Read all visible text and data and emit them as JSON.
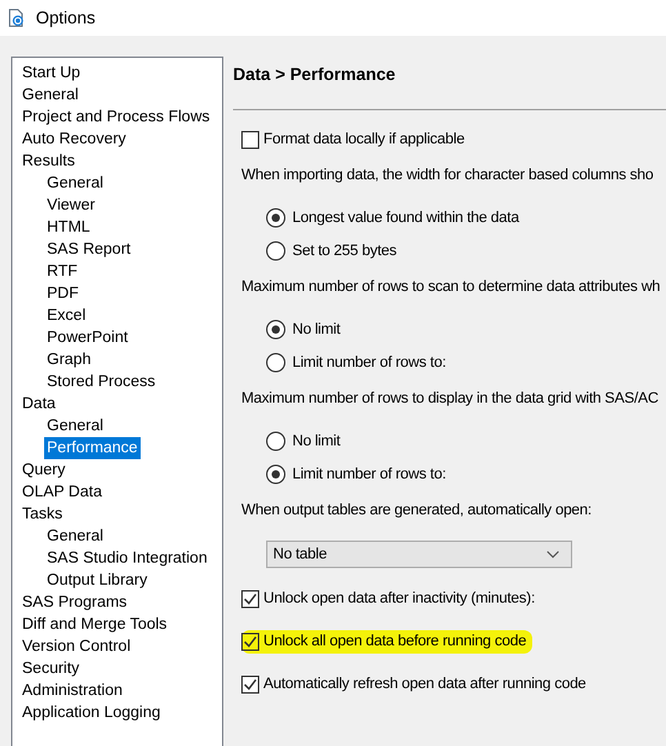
{
  "window": {
    "title": "Options"
  },
  "tree": [
    {
      "label": "Start Up",
      "selected": false
    },
    {
      "label": "General",
      "selected": false
    },
    {
      "label": "Project and Process Flows",
      "selected": false
    },
    {
      "label": "Auto Recovery",
      "selected": false
    },
    {
      "label": "Results",
      "selected": false,
      "children": [
        {
          "label": "General",
          "selected": false
        },
        {
          "label": "Viewer",
          "selected": false
        },
        {
          "label": "HTML",
          "selected": false
        },
        {
          "label": "SAS Report",
          "selected": false
        },
        {
          "label": "RTF",
          "selected": false
        },
        {
          "label": "PDF",
          "selected": false
        },
        {
          "label": "Excel",
          "selected": false
        },
        {
          "label": "PowerPoint",
          "selected": false
        },
        {
          "label": "Graph",
          "selected": false
        },
        {
          "label": "Stored Process",
          "selected": false
        }
      ]
    },
    {
      "label": "Data",
      "selected": false,
      "children": [
        {
          "label": "General",
          "selected": false
        },
        {
          "label": "Performance",
          "selected": true
        }
      ]
    },
    {
      "label": "Query",
      "selected": false
    },
    {
      "label": "OLAP Data",
      "selected": false
    },
    {
      "label": "Tasks",
      "selected": false,
      "children": [
        {
          "label": "General",
          "selected": false
        },
        {
          "label": "SAS Studio Integration",
          "selected": false
        },
        {
          "label": "Output Library",
          "selected": false
        }
      ]
    },
    {
      "label": "SAS Programs",
      "selected": false
    },
    {
      "label": "Diff and Merge Tools",
      "selected": false
    },
    {
      "label": "Version Control",
      "selected": false
    },
    {
      "label": "Security",
      "selected": false
    },
    {
      "label": "Administration",
      "selected": false
    },
    {
      "label": "Application Logging",
      "selected": false
    }
  ],
  "panel": {
    "heading": "Data > Performance",
    "controls": [
      {
        "kind": "checkbox",
        "label": "Format data locally if applicable",
        "checked": false,
        "highlighted": false
      },
      {
        "kind": "text",
        "label": "When importing data, the width for character based columns sho"
      },
      {
        "kind": "radio",
        "label": "Longest value found within the data",
        "selected": true
      },
      {
        "kind": "radio",
        "label": "Set to 255 bytes",
        "selected": false
      },
      {
        "kind": "text",
        "label": "Maximum number of rows to scan to determine data attributes wh"
      },
      {
        "kind": "radio",
        "label": "No limit",
        "selected": true
      },
      {
        "kind": "radio",
        "label": "Limit number of rows to:",
        "selected": false
      },
      {
        "kind": "text",
        "label": "Maximum number of rows to display in the data grid with SAS/AC"
      },
      {
        "kind": "radio",
        "label": "No limit",
        "selected": false
      },
      {
        "kind": "radio",
        "label": "Limit number of rows to:",
        "selected": true
      },
      {
        "kind": "text",
        "label": "When output tables are generated, automatically open:"
      },
      {
        "kind": "dropdown",
        "value": "No table"
      },
      {
        "kind": "checkbox",
        "label": "Unlock open data after inactivity (minutes):",
        "checked": true,
        "highlighted": false
      },
      {
        "kind": "checkbox",
        "label": "Unlock all open data before running code",
        "checked": true,
        "highlighted": true
      },
      {
        "kind": "checkbox",
        "label": "Automatically refresh open data after running code",
        "checked": true,
        "highlighted": false
      }
    ]
  }
}
